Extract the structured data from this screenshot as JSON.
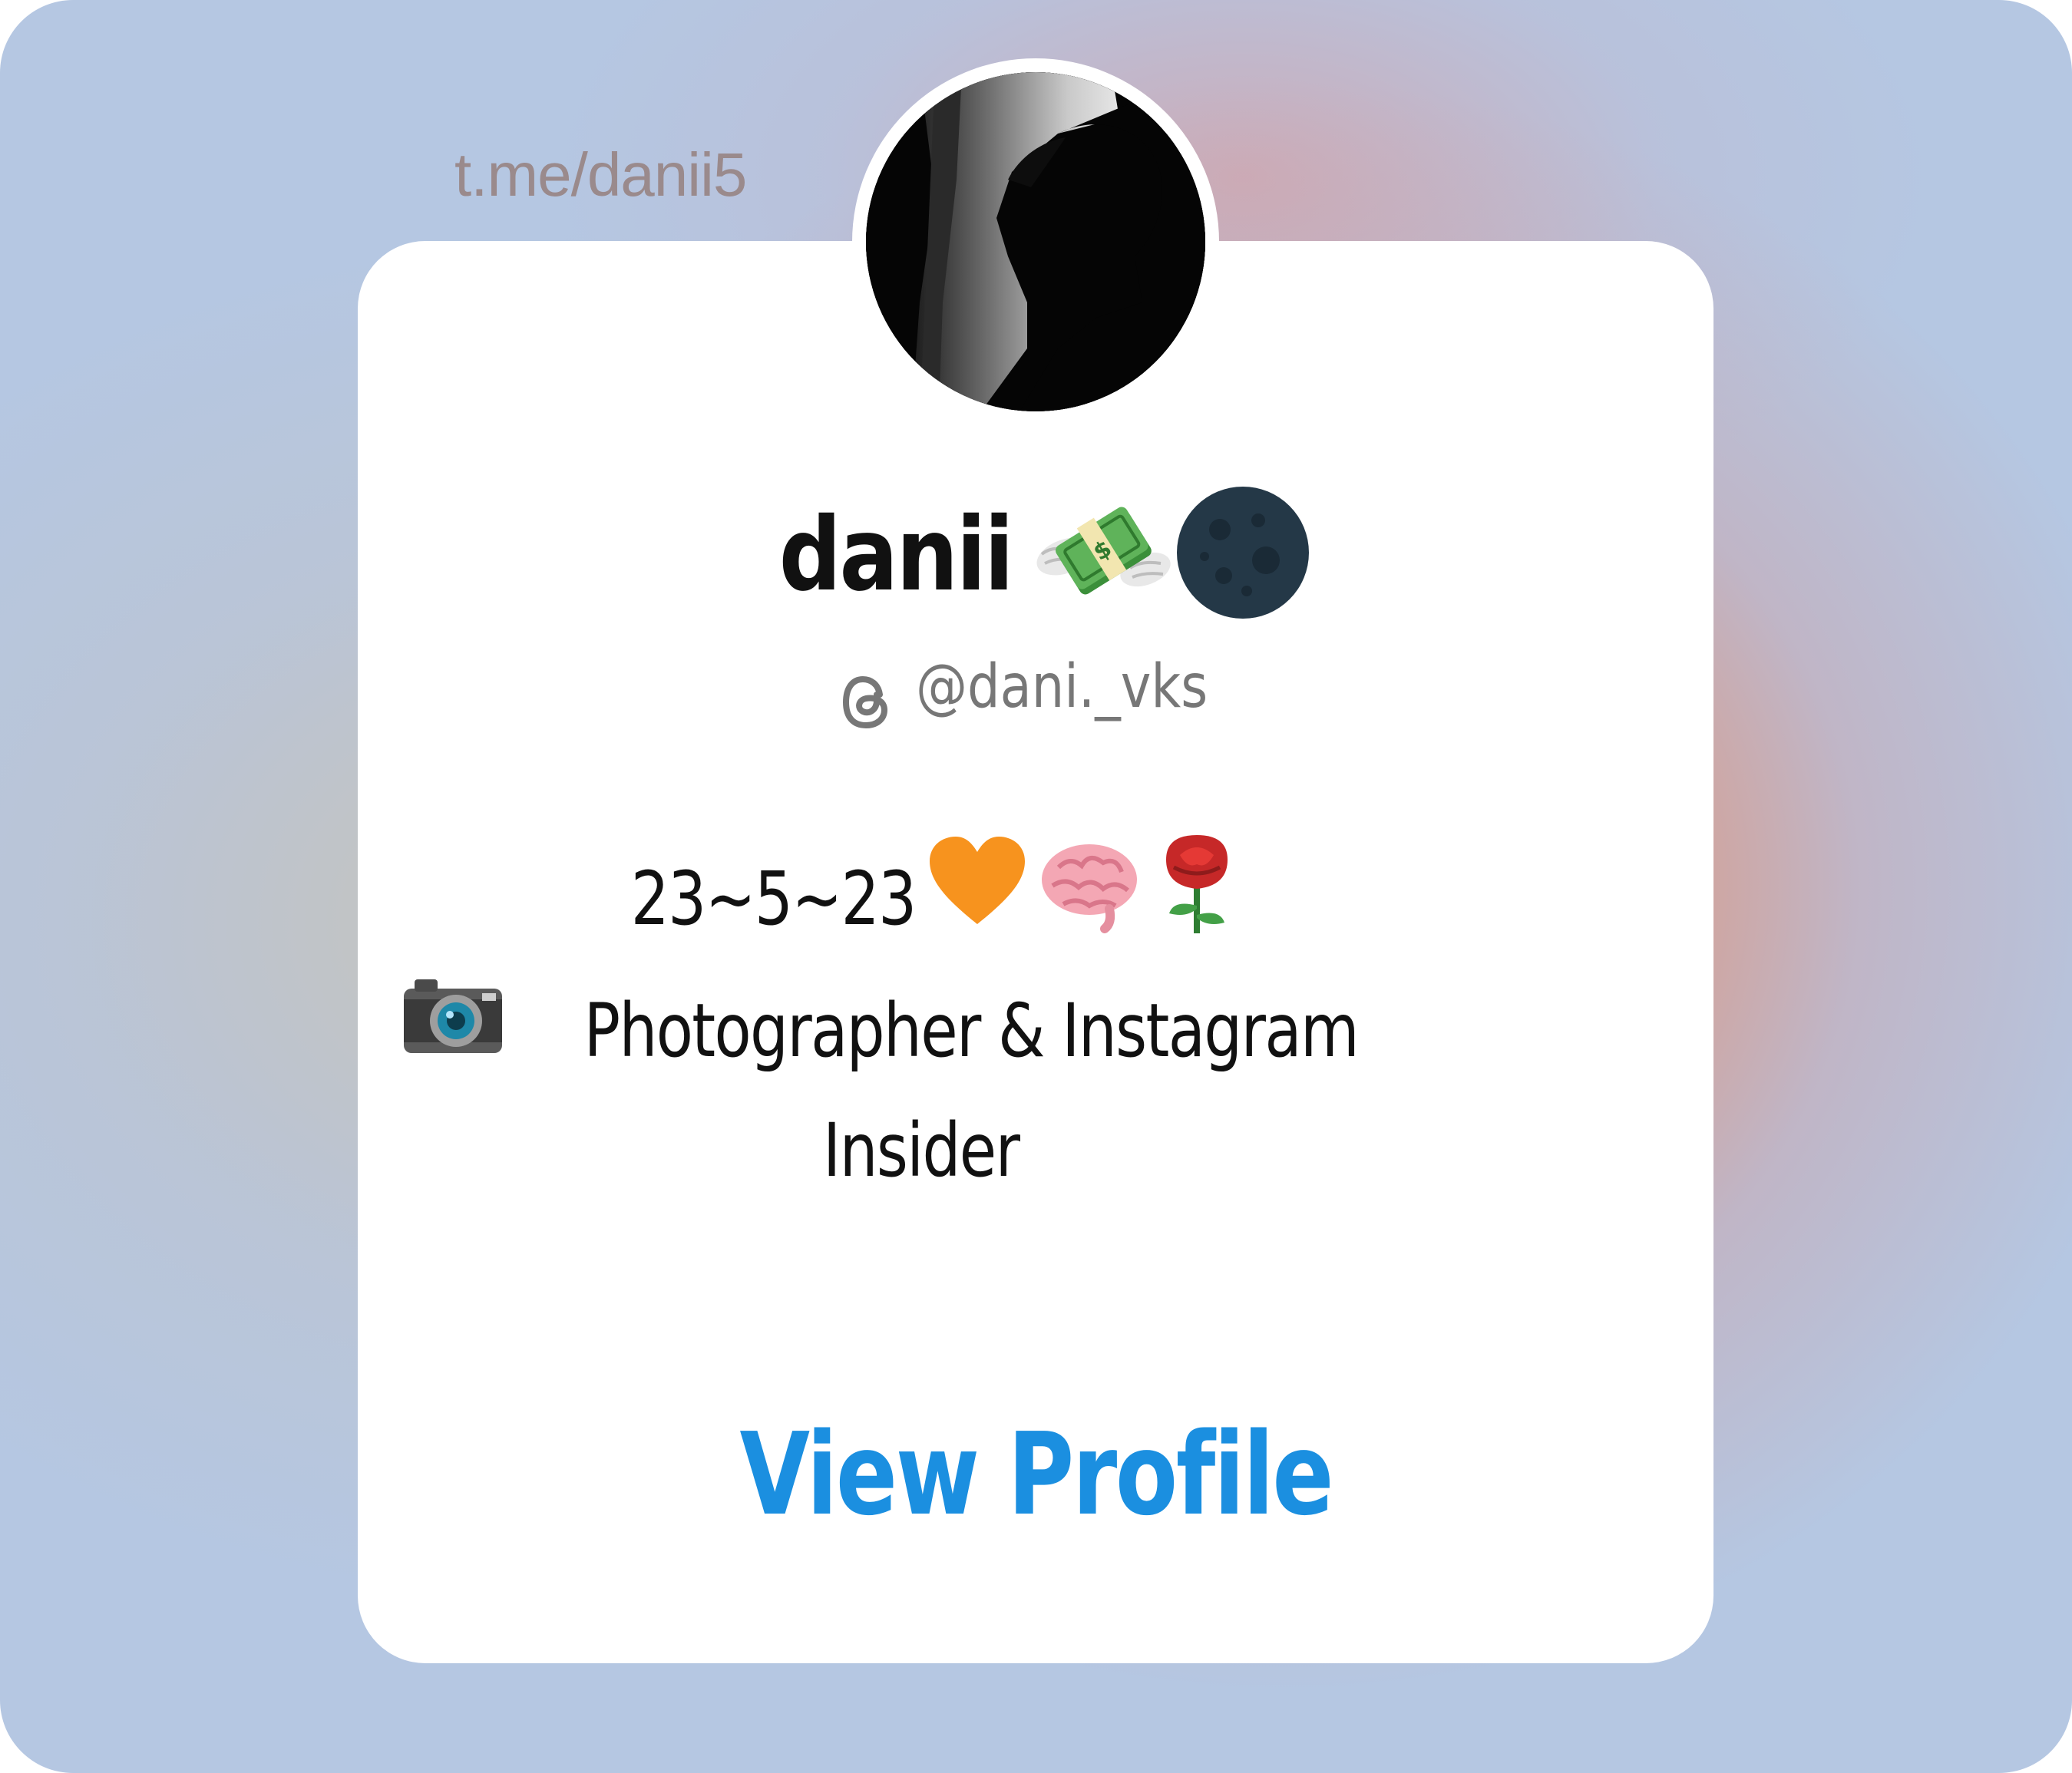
{
  "header": {
    "link": "t.me/danii5"
  },
  "profile": {
    "display_name": "danii",
    "name_emojis": [
      "money-with-wings-icon",
      "new-moon-icon"
    ],
    "handle": "@dani._vks",
    "handle_icon": "threads-icon"
  },
  "bio": {
    "line1": "23~5~23",
    "line1_emojis": [
      "orange-heart-icon",
      "brain-icon",
      "rose-icon"
    ],
    "line2": "Photographer & Instagram",
    "line2_icon": "camera-icon",
    "line3": "Insider"
  },
  "actions": {
    "view_profile": "View Profile"
  },
  "colors": {
    "accent": "#1b8fe0",
    "card": "#ffffff",
    "text": "#111111",
    "muted": "#777777"
  }
}
